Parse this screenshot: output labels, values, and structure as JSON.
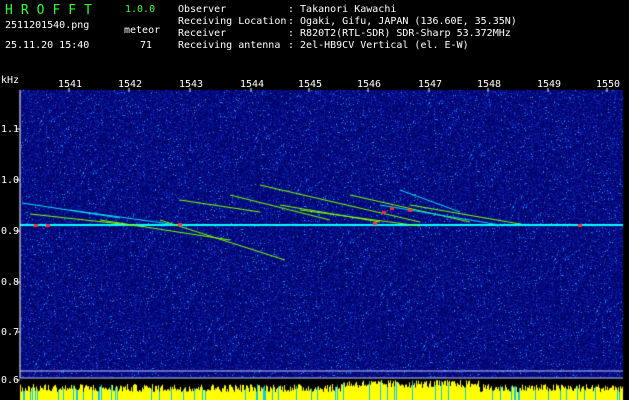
{
  "header": {
    "app_title": "HROFFT",
    "version": "1.0.0",
    "filename": "2511201540.png",
    "datetime": "25.11.20 15:40",
    "meteor_label": "meteor",
    "meteor_count": "71"
  },
  "info": [
    {
      "key": "Observer",
      "value": ": Takanori Kawachi"
    },
    {
      "key": "Receiving Location",
      "value": ": Ogaki, Gifu, JAPAN (136.60E, 35.35N)"
    },
    {
      "key": "Receiver",
      "value": ": R820T2(RTL-SDR) SDR-Sharp 53.372MHz"
    },
    {
      "key": "Receiving antenna",
      "value": ": 2el-HB9CV Vertical (el. E-W)"
    }
  ],
  "axes": {
    "unit": "kHz",
    "y_ticks": [
      "1.1",
      "1.0",
      "0.9",
      "0.8",
      "0.7",
      "0.6"
    ],
    "x_ticks": [
      "1541",
      "1542",
      "1543",
      "1544",
      "1545",
      "1546",
      "1547",
      "1548",
      "1549",
      "1550"
    ]
  },
  "colors": {
    "background": "#000080",
    "carrier": "#00ffff",
    "echo": "#7fff00",
    "peak": "#ff3030",
    "level_bar": "#ffff00"
  }
}
